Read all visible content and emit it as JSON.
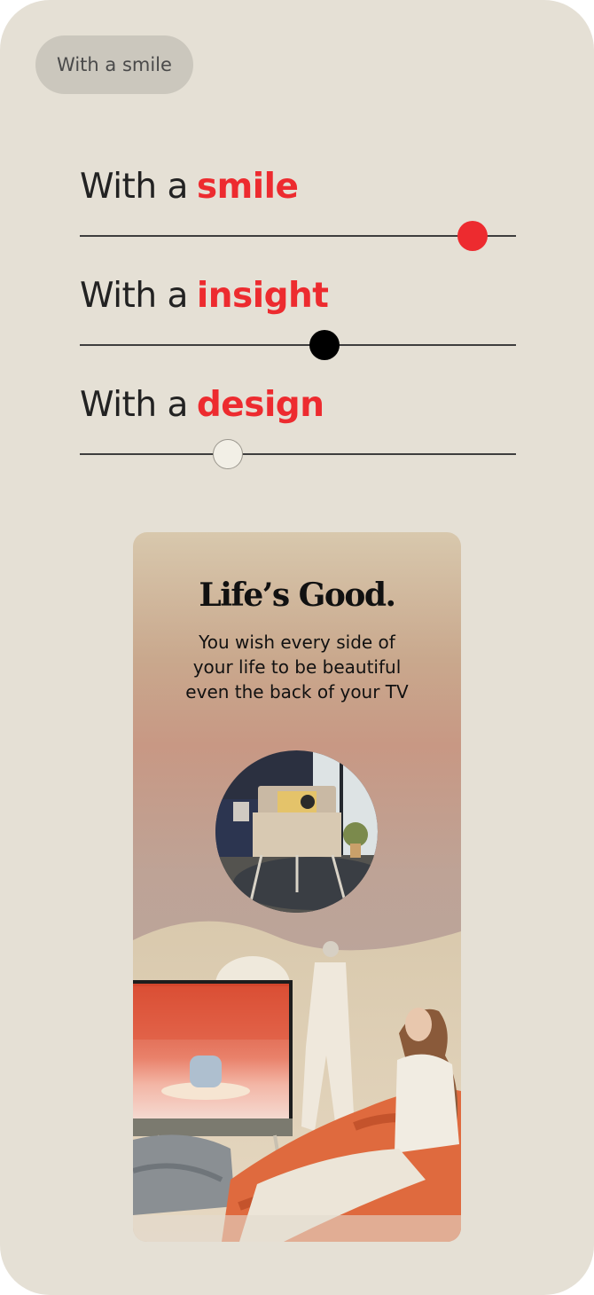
{
  "chip": {
    "label": "With a smile"
  },
  "sliders": [
    {
      "prefix": "With a",
      "highlight": "smile",
      "value": 0.9,
      "knob_color": "#ed2b2f"
    },
    {
      "prefix": "With a",
      "highlight": "insight",
      "value": 0.56,
      "knob_color": "#000000"
    },
    {
      "prefix": "With a",
      "highlight": "design",
      "value": 0.34,
      "knob_color": "#f2efe6"
    }
  ],
  "ad": {
    "brand": "Life’s Good.",
    "tagline": [
      "You wish every side of",
      "your life to be beautiful",
      "even the back of your TV"
    ]
  },
  "colors": {
    "background": "#e5e0d5",
    "accent": "#ed2b2f",
    "chip": "#cbc7bd"
  }
}
